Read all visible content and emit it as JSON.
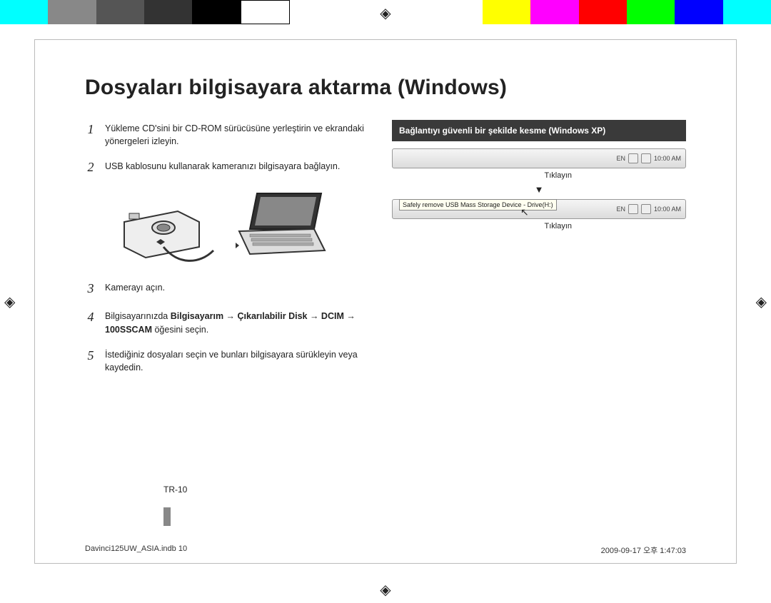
{
  "heading": "Dosyaları bilgisayara aktarma (Windows)",
  "steps": [
    {
      "num": "1",
      "text_parts": [
        "Yükleme CD'sini bir CD-ROM sürücüsüne yerleştirin ve ekrandaki yönergeleri izleyin."
      ]
    },
    {
      "num": "2",
      "text_parts": [
        "USB kablosunu kullanarak kameranızı bilgisayara bağlayın."
      ]
    },
    {
      "num": "3",
      "text_parts": [
        "Kamerayı açın."
      ]
    },
    {
      "num": "4",
      "text_parts": [
        "Bilgisayarınızda ",
        "Bilgisayarım → Çıkarılabilir Disk → DCIM → 100SSCAM",
        " öğesini seçin."
      ]
    },
    {
      "num": "5",
      "text_parts": [
        "İstediğiniz dosyaları seçin ve bunları bilgisayara sürükleyin veya kaydedin."
      ]
    }
  ],
  "callout": "Bağlantıyı güvenli bir şekilde kesme (Windows XP)",
  "taskbar_time": "10:00 AM",
  "taskbar_lang": "EN",
  "tooltip_text": "Safely remove USB Mass Storage Device - Drive(H:)",
  "click_label": "Tıklayın",
  "page_number": "TR-10",
  "footer_left": "Davinci125UW_ASIA.indb   10",
  "footer_right": "2009-09-17   오후 1:47:03"
}
